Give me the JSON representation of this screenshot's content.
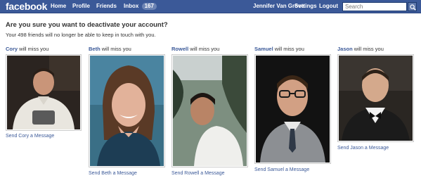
{
  "topbar": {
    "logo": "facebook",
    "nav": {
      "home": "Home",
      "profile": "Profile",
      "friends": "Friends",
      "inbox": "Inbox",
      "inbox_count": "167",
      "user": "Jennifer Van Grove",
      "settings": "Settings",
      "logout": "Logout"
    },
    "search_placeholder": "Search",
    "brand_color": "#3b5998"
  },
  "main": {
    "heading": "Are you sure you want to deactivate your account?",
    "subheading": "Your 498 friends will no longer be able to keep in touch with you.",
    "friends": [
      {
        "name": "Cory",
        "caption_suffix": " will miss you",
        "link": "Send Cory a Message"
      },
      {
        "name": "Beth",
        "caption_suffix": " will miss you",
        "link": "Send Beth a Message"
      },
      {
        "name": "Rowell",
        "caption_suffix": " will miss you",
        "link": "Send Rowell a Message"
      },
      {
        "name": "Samuel",
        "caption_suffix": " will miss you",
        "link": "Send Samuel a Message"
      },
      {
        "name": "Jason",
        "caption_suffix": " will miss you",
        "link": "Send Jason a Message"
      }
    ]
  }
}
